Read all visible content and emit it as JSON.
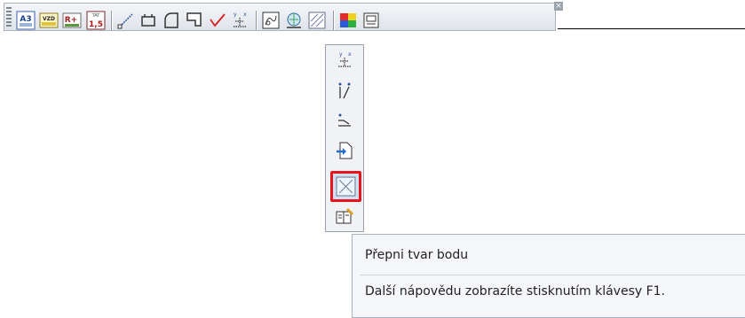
{
  "toolbar": {
    "badges": {
      "a3_top": "A3",
      "vzd": "VZD",
      "r_plus": "R+",
      "tat": "TAT",
      "tat_num": "1,5"
    }
  },
  "flyout": {
    "coord_labels": {
      "x": "x",
      "y": "y"
    }
  },
  "tooltip": {
    "title": "Přepni tvar bodu",
    "help": "Další nápovědu zobrazíte stisknutím klávesy F1."
  },
  "colors": {
    "highlight_border": "#e8141a",
    "toolbar_bg": "#e6eaef"
  }
}
